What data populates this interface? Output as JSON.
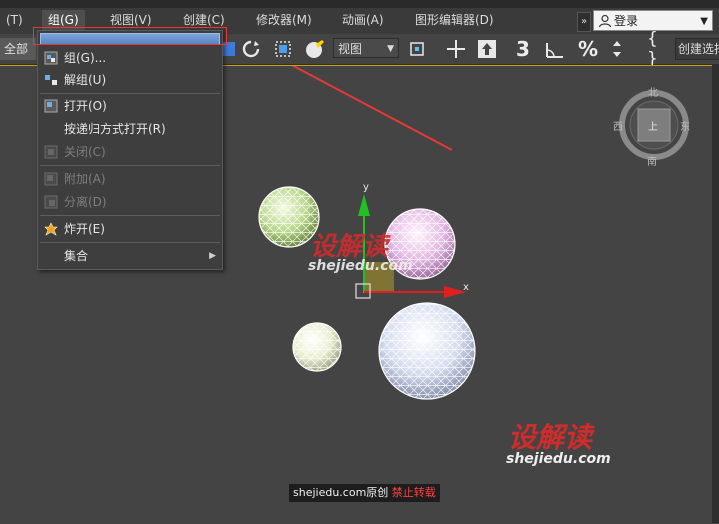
{
  "menubar": {
    "items": [
      {
        "label": "(T)"
      },
      {
        "label": "组(G)"
      },
      {
        "label": "视图(V)"
      },
      {
        "label": "创建(C)"
      },
      {
        "label": "修改器(M)"
      },
      {
        "label": "动画(A)"
      },
      {
        "label": "图形编辑器(D)"
      }
    ],
    "more": "»",
    "login": "登录"
  },
  "toolbar": {
    "selection_filter": "全部",
    "view_dropdown": "视图",
    "snap_label": "3",
    "create_selection": "创建选择"
  },
  "group_menu": {
    "items": [
      {
        "label": "组(G)..."
      },
      {
        "label": "解组(U)"
      },
      {
        "label": "打开(O)"
      },
      {
        "label": "按递归方式打开(R)"
      },
      {
        "label": "关闭(C)"
      },
      {
        "label": "附加(A)"
      },
      {
        "label": "分离(D)"
      },
      {
        "label": "炸开(E)"
      },
      {
        "label": "集合"
      }
    ]
  },
  "viewcube": {
    "north": "北",
    "south": "南",
    "east": "东",
    "west": "西",
    "face": "上"
  },
  "gizmo": {
    "x_label": "x",
    "y_label": "y"
  },
  "watermarks": {
    "brand_cn": "设解读",
    "brand_url": "shejiedu.com",
    "credit_site": "shejiedu.com原创",
    "credit_warning": "禁止转载"
  },
  "colors": {
    "accent_yellow": "#c8a400",
    "annotation_red": "#e53935",
    "menu_highlight": "#5b84c4"
  }
}
